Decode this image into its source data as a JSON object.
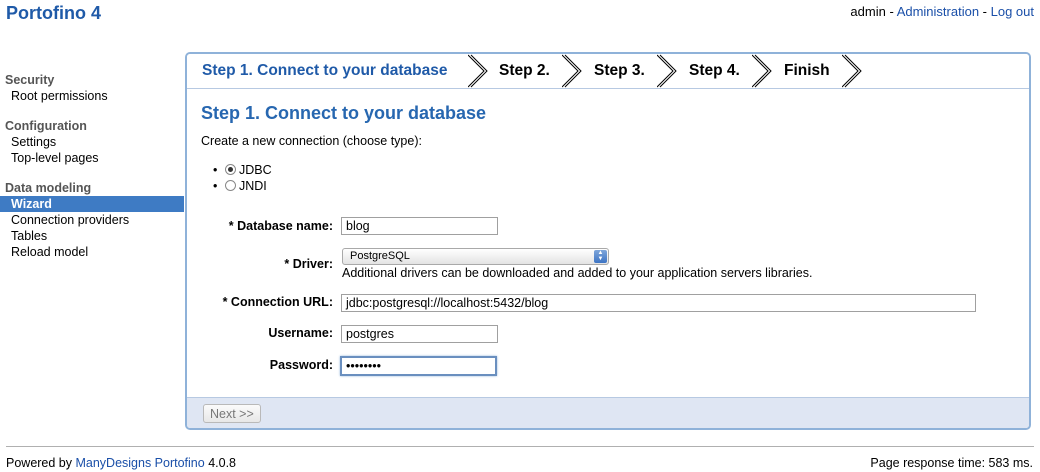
{
  "app_title": "Portofino 4",
  "user_nav": {
    "user": "admin",
    "sep1": " - ",
    "admin_link": "Administration",
    "sep2": " - ",
    "logout_link": "Log out"
  },
  "sidebar": {
    "sections": [
      {
        "title": "Security",
        "items": [
          "Root permissions"
        ]
      },
      {
        "title": "Configuration",
        "items": [
          "Settings",
          "Top-level pages"
        ]
      },
      {
        "title": "Data modeling",
        "items": [
          "Wizard",
          "Connection providers",
          "Tables",
          "Reload model"
        ],
        "active": "Wizard"
      }
    ]
  },
  "steps": [
    "Step 1. Connect to your database",
    "Step 2.",
    "Step 3.",
    "Step 4.",
    "Finish"
  ],
  "main": {
    "heading": "Step 1. Connect to your database",
    "intro": "Create a new connection (choose type):",
    "connection_types": [
      {
        "label": "JDBC",
        "checked": true
      },
      {
        "label": "JNDI",
        "checked": false
      }
    ]
  },
  "form": {
    "database_name": {
      "label": "* Database name:",
      "value": "blog"
    },
    "driver": {
      "label": "* Driver:",
      "value": "PostgreSQL",
      "help": "Additional drivers can be downloaded and added to your application servers libraries."
    },
    "connection_url": {
      "label": "* Connection URL:",
      "value": "jdbc:postgresql://localhost:5432/blog"
    },
    "username": {
      "label": "Username:",
      "value": "postgres"
    },
    "password": {
      "label": "Password:",
      "value": "••••••••"
    }
  },
  "buttons": {
    "next": "Next >>"
  },
  "footer": {
    "powered_prefix": "Powered by ",
    "powered_link": "ManyDesigns Portofino",
    "version": " 4.0.8",
    "response_time": "Page response time: 583 ms."
  }
}
